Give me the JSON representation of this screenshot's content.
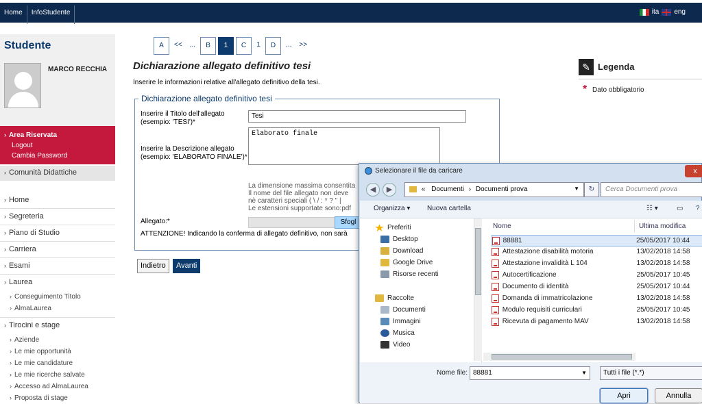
{
  "topbar": {
    "nav": [
      "Home",
      "InfoStudente"
    ],
    "lang_ita": "ita",
    "lang_eng": "eng"
  },
  "sidebar": {
    "title": "Studente",
    "user_name": "MARCO RECCHIA",
    "area_riservata": "Area Riservata",
    "logout": "Logout",
    "cambia_password": "Cambia Password",
    "comunita": "Comunità Didattiche",
    "menu": [
      "Home",
      "Segreteria",
      "Piano di Studio",
      "Carriera",
      "Esami",
      "Laurea"
    ],
    "laurea_sub": [
      "Conseguimento Titolo",
      "AlmaLaurea"
    ],
    "tirocini": "Tirocini e stage",
    "tirocini_sub": [
      "Aziende",
      "Le mie opportunità",
      "Le mie candidature",
      "Le mie ricerche salvate",
      "Accesso ad AlmaLaurea",
      "Proposta di stage"
    ]
  },
  "pager": [
    "A",
    "<<",
    "...",
    "B",
    "1",
    "C",
    "1",
    "D",
    "...",
    ">>"
  ],
  "form": {
    "title": "Dichiarazione allegato definitivo tesi",
    "intro": "Inserire le informazioni relative all'allegato definitivo della tesi.",
    "legend": "Dichiarazione allegato definitivo tesi",
    "titolo_label_1": "Inserire il Titolo dell'allegato",
    "titolo_label_2": "(esempio: 'TESI')*",
    "titolo_value": "Tesi",
    "descr_label_1": "Inserire la Descrizione allegato",
    "descr_label_2": "(esempio: 'ELABORATO FINALE')*",
    "descr_value": "Elaborato finale",
    "info_1": "La dimensione massima consentita",
    "info_2": "Il nome del file allegato non deve",
    "info_3": "nè caratteri speciali ( \\ / : * ? \" |",
    "info_4": "Le estensioni supportate sono:pdf",
    "allegato_label": "Allegato:*",
    "browse": "Sfogl",
    "warning": "ATTENZIONE! Indicando la conferma di allegato definitivo, non sarà",
    "btn_back": "Indietro",
    "btn_next": "Avanti"
  },
  "legenda": {
    "title": "Legenda",
    "text": "Dato obbligatorio"
  },
  "dialog": {
    "title": "Selezionare il file da caricare",
    "close": "x",
    "address": [
      "«",
      "Documenti",
      "Documenti prova"
    ],
    "search_placeholder": "Cerca Documenti prova",
    "toolbar_organizza": "Organizza ▾",
    "toolbar_nuova": "Nuova cartella",
    "tree": [
      {
        "label": "Preferiti",
        "icon": "star-icon",
        "color": "#f0b400"
      },
      {
        "label": "Desktop",
        "icon": "desktop-icon",
        "color": "#3a6ea5"
      },
      {
        "label": "Download",
        "icon": "download-icon",
        "color": "#d8b040"
      },
      {
        "label": "Google Drive",
        "icon": "drive-icon",
        "color": "#e0b840"
      },
      {
        "label": "Risorse recenti",
        "icon": "recent-icon",
        "color": "#8a9aaa"
      },
      {
        "label": "Raccolte",
        "icon": "library-icon",
        "color": "#e0b840"
      },
      {
        "label": "Documenti",
        "icon": "documents-icon",
        "color": "#aab8c8"
      },
      {
        "label": "Immagini",
        "icon": "images-icon",
        "color": "#5a8ab8"
      },
      {
        "label": "Musica",
        "icon": "music-icon",
        "color": "#2a5a9a"
      },
      {
        "label": "Video",
        "icon": "video-icon",
        "color": "#333"
      }
    ],
    "col_nome": "Nome",
    "col_data": "Ultima modifica",
    "files": [
      {
        "name": "88881",
        "date": "25/05/2017 10:44"
      },
      {
        "name": "Attestazione disabilità motoria",
        "date": "13/02/2018 14:58"
      },
      {
        "name": "Attestazione invalidità L 104",
        "date": "13/02/2018 14:58"
      },
      {
        "name": "Autocertificazione",
        "date": "25/05/2017 10:45"
      },
      {
        "name": "Documento di identità",
        "date": "25/05/2017 10:44"
      },
      {
        "name": "Domanda di immatricolazione",
        "date": "13/02/2018 14:58"
      },
      {
        "name": "Modulo requisiti curriculari",
        "date": "25/05/2017 10:45"
      },
      {
        "name": "Ricevuta di pagamento MAV",
        "date": "13/02/2018 14:58"
      }
    ],
    "fname_label": "Nome file:",
    "fname_value": "88881",
    "ftype": "Tutti i file (*.*)",
    "btn_apri": "Apri",
    "btn_annulla": "Annulla"
  }
}
